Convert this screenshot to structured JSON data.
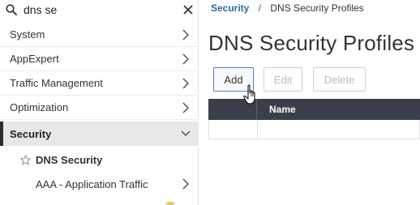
{
  "search": {
    "value": "dns se",
    "icon": "search-icon",
    "clear_icon": "close-icon"
  },
  "sidebar": {
    "items": [
      {
        "label": "System",
        "icon": "chevron-right-icon"
      },
      {
        "label": "AppExpert",
        "icon": "chevron-right-icon"
      },
      {
        "label": "Traffic Management",
        "icon": "chevron-right-icon"
      },
      {
        "label": "Optimization",
        "icon": "chevron-right-icon"
      },
      {
        "label": "Security",
        "icon": "chevron-down-icon",
        "active": true
      }
    ],
    "sub_items": [
      {
        "label": "DNS Security",
        "icon": "star-icon"
      },
      {
        "label": "AAA - Application Traffic",
        "icon": "chevron-right-icon"
      }
    ]
  },
  "breadcrumb": {
    "root": "Security",
    "separator": "/",
    "current": "DNS Security Profiles"
  },
  "page": {
    "title": "DNS Security Profiles"
  },
  "toolbar": {
    "add_label": "Add",
    "edit_label": "Edit",
    "delete_label": "Delete"
  },
  "table": {
    "columns": [
      "",
      "Name"
    ],
    "rows": []
  },
  "colors": {
    "accent": "#2d6aa3",
    "header_bg": "#3a3f4b",
    "active_bg": "#e8e8e8"
  }
}
